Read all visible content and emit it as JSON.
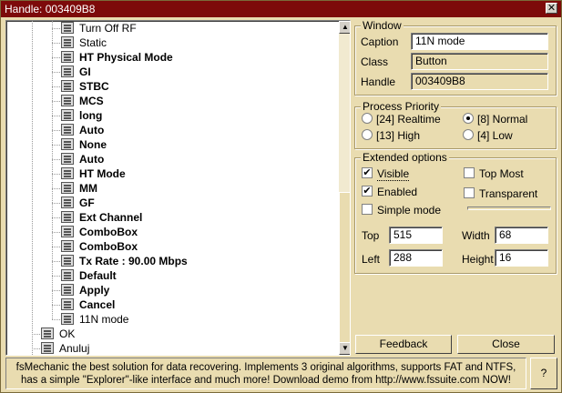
{
  "title": "Handle: 003409B8",
  "close_glyph": "✕",
  "tree": {
    "items": [
      {
        "label": "Turn Off RF",
        "bold": false
      },
      {
        "label": "Static",
        "bold": false
      },
      {
        "label": "HT Physical Mode",
        "bold": true
      },
      {
        "label": "GI",
        "bold": true
      },
      {
        "label": "STBC",
        "bold": true
      },
      {
        "label": "MCS",
        "bold": true
      },
      {
        "label": "long",
        "bold": true
      },
      {
        "label": "Auto",
        "bold": true
      },
      {
        "label": "None",
        "bold": true
      },
      {
        "label": "Auto",
        "bold": true
      },
      {
        "label": "HT Mode",
        "bold": true
      },
      {
        "label": "MM",
        "bold": true
      },
      {
        "label": "GF",
        "bold": true
      },
      {
        "label": "Ext Channel",
        "bold": true
      },
      {
        "label": "ComboBox",
        "bold": true
      },
      {
        "label": "ComboBox",
        "bold": true
      },
      {
        "label": "Tx Rate : 90.00 Mbps",
        "bold": true
      },
      {
        "label": "Default",
        "bold": true
      },
      {
        "label": "Apply",
        "bold": true
      },
      {
        "label": "Cancel",
        "bold": true
      },
      {
        "label": "11N mode",
        "bold": false
      },
      {
        "label": "OK",
        "bold": false
      },
      {
        "label": "Anuluj",
        "bold": false
      }
    ]
  },
  "window_group": {
    "legend": "Window",
    "caption_label": "Caption",
    "caption_value": "11N mode",
    "class_label": "Class",
    "class_value": "Button",
    "handle_label": "Handle",
    "handle_value": "003409B8"
  },
  "priority_group": {
    "legend": "Process Priority",
    "options": [
      {
        "label": "[24]  Realtime",
        "selected": false
      },
      {
        "label": "[8]  Normal",
        "selected": true
      },
      {
        "label": "[13]  High",
        "selected": false
      },
      {
        "label": "[4]  Low",
        "selected": false
      }
    ]
  },
  "extended_group": {
    "legend": "Extended options",
    "visible_label": "Visible",
    "visible_checked": true,
    "topmost_label": "Top Most",
    "topmost_checked": false,
    "enabled_label": "Enabled",
    "enabled_checked": true,
    "transparent_label": "Transparent",
    "transparent_checked": false,
    "simple_label": "Simple mode",
    "simple_checked": false,
    "top_label": "Top",
    "top_value": "515",
    "width_label": "Width",
    "width_value": "68",
    "left_label": "Left",
    "left_value": "288",
    "height_label": "Height",
    "height_value": "16"
  },
  "buttons": {
    "feedback": "Feedback",
    "close": "Close",
    "help": "?"
  },
  "status": {
    "line1": "fsMechanic the best solution for data recovering. Implements 3 original algorithms, supports FAT and NTFS,",
    "line2": "has a simple \"Explorer\"-like interface and much more! Download demo from http://www.fssuite.com NOW!"
  }
}
